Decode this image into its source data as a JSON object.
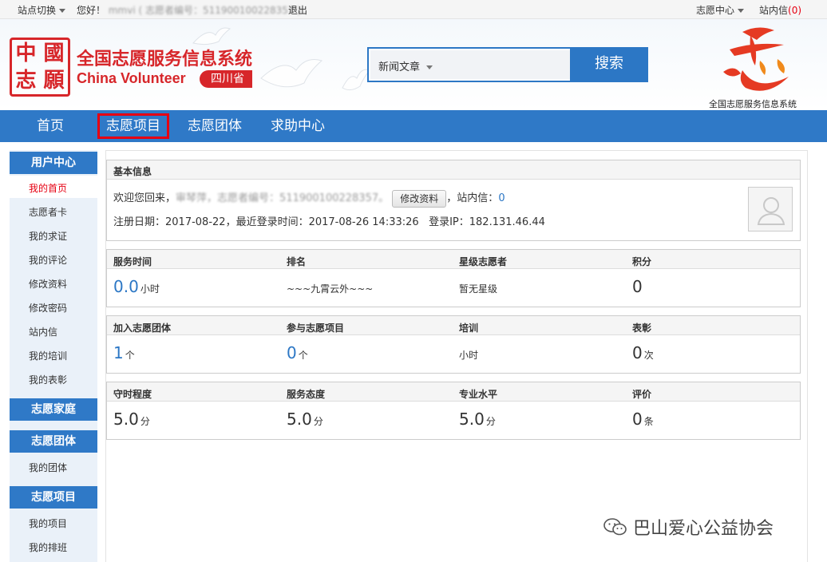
{
  "topbar": {
    "site_switch": "站点切换",
    "greeting": "您好！",
    "username": "mmvi",
    "volunteer_no_label": "( 志愿者编号：",
    "volunteer_no": "511900100228357",
    "volunteer_no_close": " )",
    "logout": "退出",
    "volunteer_center": "志愿中心",
    "messages_label": "站内信",
    "messages_count": "(0)"
  },
  "header": {
    "seal_chars": [
      "中",
      "國",
      "志",
      "願"
    ],
    "logo_cn": "全国志愿服务信息系统",
    "logo_en": "China Volunteer",
    "province": "四川省",
    "search_category": "新闻文章",
    "search_button": "搜索",
    "right_logo_glyph": "志",
    "right_logo_caption": "全国志愿服务信息系统"
  },
  "nav": {
    "items": [
      "首页",
      "志愿项目",
      "志愿团体",
      "求助中心"
    ]
  },
  "sidebar": {
    "user_center": "用户中心",
    "user_items": [
      "我的首页",
      "志愿者卡",
      "我的求证",
      "我的评论",
      "修改资料",
      "修改密码",
      "站内信",
      "我的培训",
      "我的表彰"
    ],
    "family": "志愿家庭",
    "group": "志愿团体",
    "group_items": [
      "我的团体"
    ],
    "project": "志愿项目",
    "project_items": [
      "我的项目",
      "我的排班"
    ]
  },
  "basic": {
    "title": "基本信息",
    "welcome": "欢迎您回来，",
    "masked_name": "审琴萍",
    "masked_no_label": "，志愿者编号：",
    "masked_no": "511900100228357",
    "masked_end": "。",
    "edit_button": "修改资料",
    "msg_label": "，站内信：",
    "msg_count": "0",
    "reg_label": "注册日期：",
    "reg_date": "2017-08-22",
    "last_login_label": "，最近登录时间：",
    "last_login": "2017-08-26 14:33:26",
    "ip_label": "登录IP：",
    "ip": "182.131.46.44"
  },
  "stats1": {
    "headers": [
      "服务时间",
      "排名",
      "星级志愿者",
      "积分"
    ],
    "service_hours": "0.0",
    "service_unit": "小时",
    "rank": "~~~九霄云外~~~",
    "star": "暂无星级",
    "points": "0"
  },
  "stats2": {
    "headers": [
      "加入志愿团体",
      "参与志愿项目",
      "培训",
      "表彰"
    ],
    "groups": "1",
    "groups_unit": "个",
    "projects": "0",
    "projects_unit": "个",
    "training_unit": "小时",
    "awards": "0",
    "awards_unit": "次"
  },
  "stats3": {
    "headers": [
      "守时程度",
      "服务态度",
      "专业水平",
      "评价"
    ],
    "punctuality": "5.0",
    "attitude": "5.0",
    "professional": "5.0",
    "score_unit": "分",
    "reviews": "0",
    "reviews_unit": "条"
  },
  "watermark": "巴山爱心公益协会",
  "colors": {
    "brand_blue": "#2f79c7",
    "brand_red": "#d7262a",
    "highlight_red": "#e60012"
  }
}
